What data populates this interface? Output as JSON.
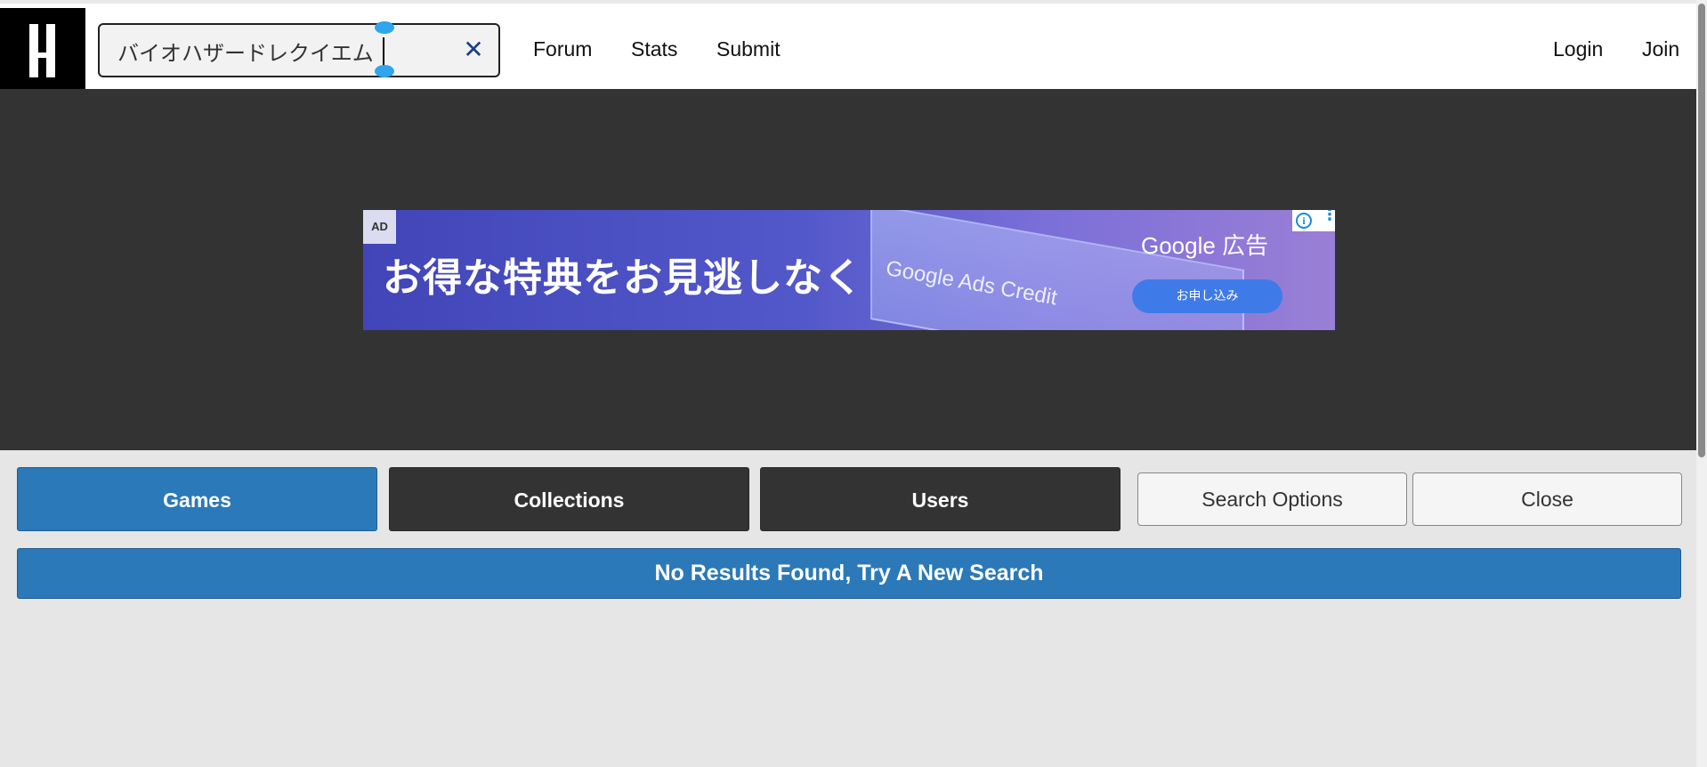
{
  "header": {
    "logo_icon": "site-logo-h",
    "search": {
      "value": "バイオハザードレクイエム",
      "clear_icon": "close-x-icon"
    },
    "nav": {
      "forum": "Forum",
      "stats": "Stats",
      "submit": "Submit"
    },
    "auth": {
      "login": "Login",
      "join": "Join"
    }
  },
  "ad": {
    "tag": "AD",
    "headline": "お得な特典をお見逃しなく",
    "card_text": "Google Ads Credit",
    "brand": "Google 広告",
    "cta": "お申し込み",
    "info_icon": "info-icon",
    "menu_icon": "kebab-menu-icon"
  },
  "tabs": {
    "games": "Games",
    "collections": "Collections",
    "users": "Users"
  },
  "buttons": {
    "search_options": "Search Options",
    "close": "Close"
  },
  "results": {
    "message": "No Results Found, Try A New Search"
  },
  "colors": {
    "primary": "#2b79b8",
    "dark": "#333333",
    "page_bg": "#e6e6e6"
  }
}
